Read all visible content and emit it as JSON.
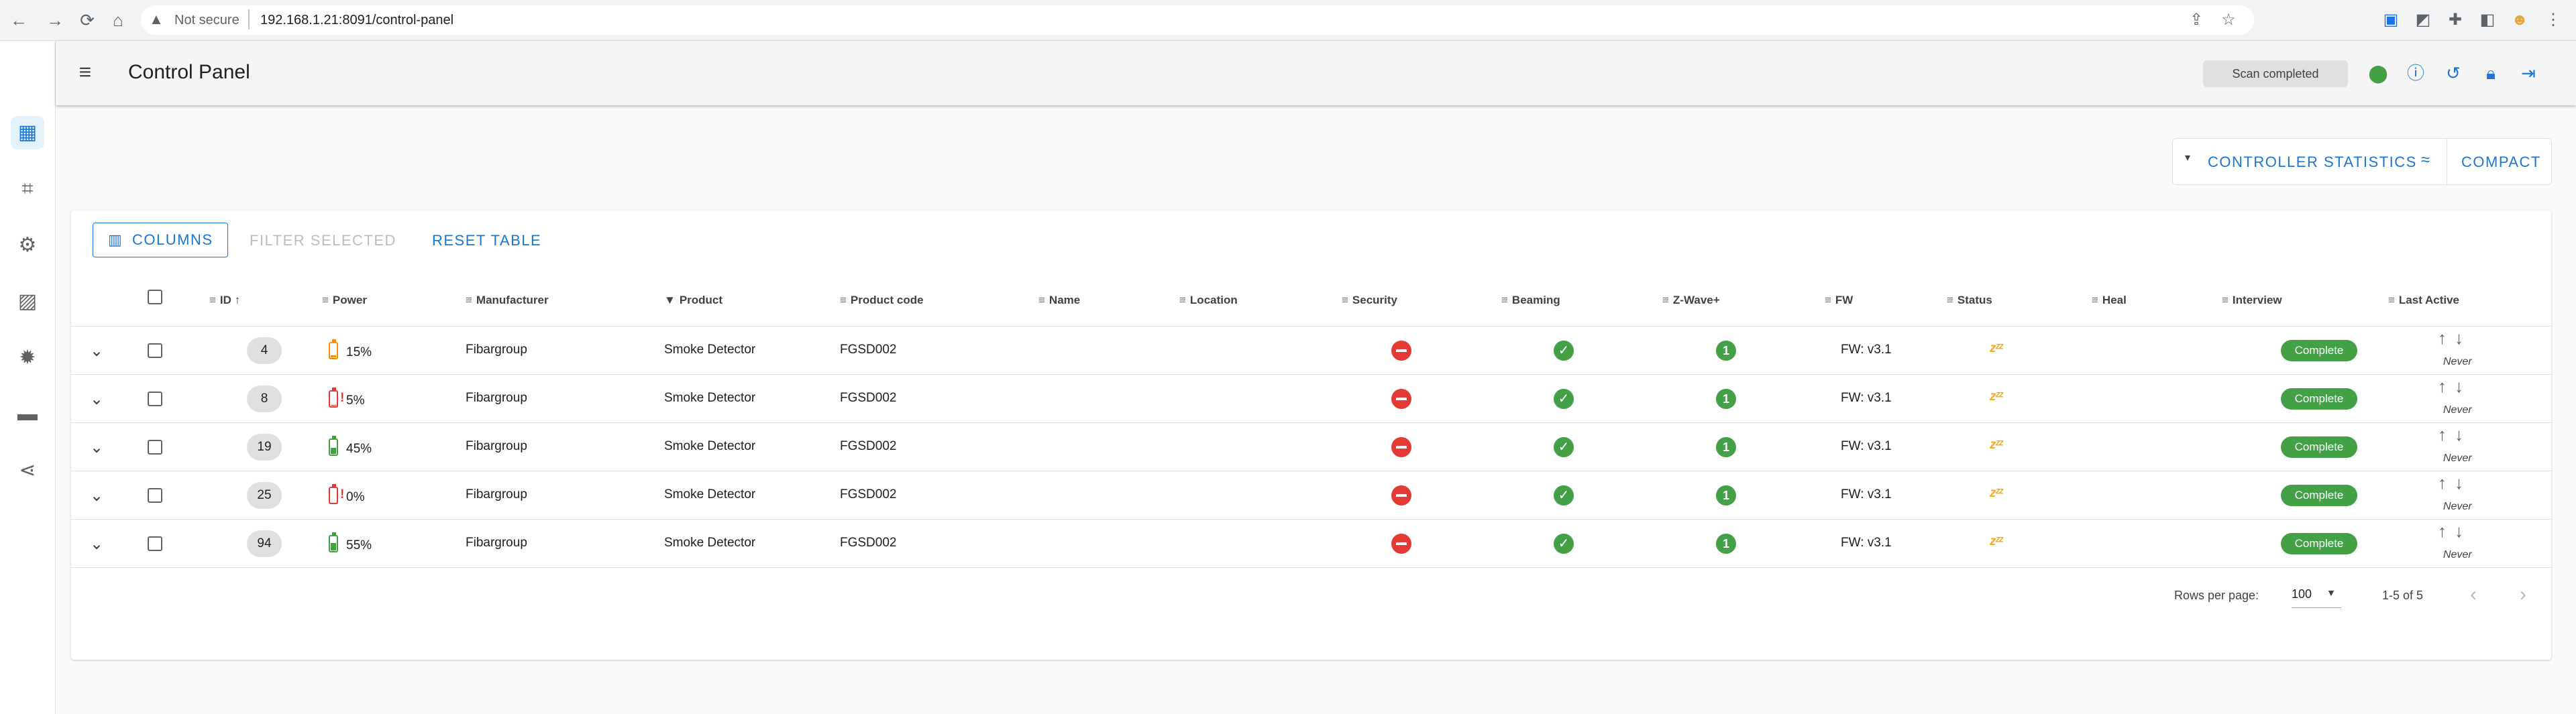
{
  "browser": {
    "security_label": "Not secure",
    "url": "192.168.1.21:8091/control-panel",
    "nav": {
      "back": "←",
      "forward": "→",
      "reload": "⟳",
      "home": "⌂"
    },
    "extensions": [
      "share-icon",
      "star-icon",
      "ext-blue-icon",
      "ext-video-icon",
      "puzzle-icon",
      "sidebar-icon",
      "avatar-icon",
      "kebab-icon"
    ]
  },
  "rail": {
    "items": [
      {
        "name": "dashboard-icon",
        "glyph": "▦",
        "active": true
      },
      {
        "name": "network-graph-icon",
        "glyph": "⌗",
        "active": false
      },
      {
        "name": "settings-icon",
        "glyph": "⚙",
        "active": false
      },
      {
        "name": "scenes-icon",
        "glyph": "▨",
        "active": false
      },
      {
        "name": "debug-icon",
        "glyph": "✹",
        "active": false
      },
      {
        "name": "store-icon",
        "glyph": "▬",
        "active": false
      },
      {
        "name": "share-icon",
        "glyph": "⋖",
        "active": false
      }
    ]
  },
  "appbar": {
    "title": "Control Panel",
    "status_chip": "Scan completed",
    "icons": [
      "zwave-status-icon",
      "info-icon",
      "history-icon",
      "lock-icon",
      "logout-icon"
    ]
  },
  "stats": {
    "caret": "▾",
    "controller_statistics": "CONTROLLER STATISTICS",
    "compact": "COMPACT"
  },
  "toolbar": {
    "columns_label": "COLUMNS",
    "filter_selected_label": "FILTER SELECTED",
    "reset_table_label": "RESET TABLE"
  },
  "table": {
    "headers": {
      "id": "ID",
      "power": "Power",
      "manufacturer": "Manufacturer",
      "product": "Product",
      "product_code": "Product code",
      "name": "Name",
      "location": "Location",
      "security": "Security",
      "beaming": "Beaming",
      "zwave_plus": "Z-Wave+",
      "fw": "FW",
      "status": "Status",
      "heal": "Heal",
      "interview": "Interview",
      "last_active": "Last Active"
    },
    "rows": [
      {
        "id": "4",
        "power": "15%",
        "battery_level": 0.15,
        "battery_color": "#fb8c00",
        "battery_low": false,
        "manufacturer": "Fibargroup",
        "product": "Smoke Detector",
        "product_code": "FGSD002",
        "zwave_plus": "1",
        "fw": "FW: v3.1",
        "status": "zᶻᶻ",
        "interview": "Complete",
        "last_active": "Never"
      },
      {
        "id": "8",
        "power": "5%",
        "battery_level": 0.05,
        "battery_color": "#e53935",
        "battery_low": true,
        "manufacturer": "Fibargroup",
        "product": "Smoke Detector",
        "product_code": "FGSD002",
        "zwave_plus": "1",
        "fw": "FW: v3.1",
        "status": "zᶻᶻ",
        "interview": "Complete",
        "last_active": "Never"
      },
      {
        "id": "19",
        "power": "45%",
        "battery_level": 0.45,
        "battery_color": "#43a047",
        "battery_low": false,
        "manufacturer": "Fibargroup",
        "product": "Smoke Detector",
        "product_code": "FGSD002",
        "zwave_plus": "1",
        "fw": "FW: v3.1",
        "status": "zᶻᶻ",
        "interview": "Complete",
        "last_active": "Never"
      },
      {
        "id": "25",
        "power": "0%",
        "battery_level": 0.0,
        "battery_color": "#e53935",
        "battery_low": true,
        "manufacturer": "Fibargroup",
        "product": "Smoke Detector",
        "product_code": "FGSD002",
        "zwave_plus": "1",
        "fw": "FW: v3.1",
        "status": "zᶻᶻ",
        "interview": "Complete",
        "last_active": "Never"
      },
      {
        "id": "94",
        "power": "55%",
        "battery_level": 0.55,
        "battery_color": "#43a047",
        "battery_low": false,
        "manufacturer": "Fibargroup",
        "product": "Smoke Detector",
        "product_code": "FGSD002",
        "zwave_plus": "1",
        "fw": "FW: v3.1",
        "status": "zᶻᶻ",
        "interview": "Complete",
        "last_active": "Never"
      }
    ]
  },
  "footer": {
    "rows_per_page_label": "Rows per page:",
    "rows_per_page_value": "100",
    "range": "1-5 of 5"
  }
}
